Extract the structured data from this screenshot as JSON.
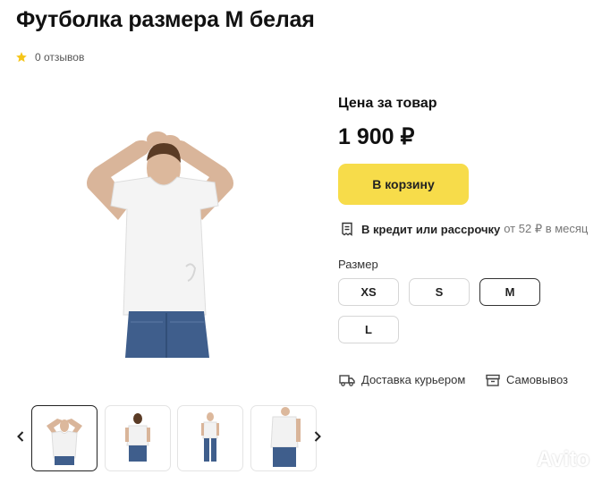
{
  "product": {
    "title": "Футболка размера М белая",
    "reviews": "0 отзывов",
    "price_label": "Цена за товар",
    "price": "1 900 ₽",
    "cart_button": "В корзину",
    "credit_strong": "В кредит или рассрочку",
    "credit_muted": "от 52 ₽ в месяц"
  },
  "sizes": {
    "label": "Размер",
    "options": [
      "XS",
      "S",
      "M",
      "L"
    ],
    "selected": "M"
  },
  "delivery": {
    "courier": "Доставка курьером",
    "pickup": "Самовывоз"
  },
  "watermark": "Avito",
  "colors": {
    "accent": "#f7dc4a",
    "star": "#f5c518"
  },
  "icons": {
    "rating": "star-icon",
    "credit": "receipt-icon",
    "courier": "truck-icon",
    "pickup": "box-icon",
    "prev": "chevron-left-icon",
    "next": "chevron-right-icon"
  }
}
